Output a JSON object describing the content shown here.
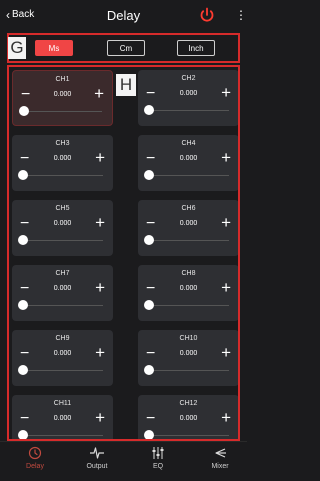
{
  "header": {
    "back_label": "Back",
    "title": "Delay",
    "power_icon": "power-icon",
    "more_icon": "more-vertical-icon"
  },
  "units": {
    "options": [
      "Ms",
      "Cm",
      "Inch"
    ],
    "selected": "Ms"
  },
  "annotations": {
    "g": "G",
    "h": "H"
  },
  "channels": [
    {
      "name": "CH1",
      "value": "0.000"
    },
    {
      "name": "CH2",
      "value": "0.000"
    },
    {
      "name": "CH3",
      "value": "0.000"
    },
    {
      "name": "CH4",
      "value": "0.000"
    },
    {
      "name": "CH5",
      "value": "0.000"
    },
    {
      "name": "CH6",
      "value": "0.000"
    },
    {
      "name": "CH7",
      "value": "0.000"
    },
    {
      "name": "CH8",
      "value": "0.000"
    },
    {
      "name": "CH9",
      "value": "0.000"
    },
    {
      "name": "CH10",
      "value": "0.000"
    },
    {
      "name": "CH11",
      "value": "0.000"
    },
    {
      "name": "CH12",
      "value": "0.000"
    }
  ],
  "controls": {
    "minus": "−",
    "plus": "+"
  },
  "tabs": [
    {
      "label": "Delay",
      "icon": "clock-icon",
      "active": true
    },
    {
      "label": "Output",
      "icon": "waveform-icon",
      "active": false
    },
    {
      "label": "EQ",
      "icon": "equalizer-icon",
      "active": false
    },
    {
      "label": "Mixer",
      "icon": "mixer-icon",
      "active": false
    }
  ],
  "colors": {
    "accent": "#f04545",
    "highlight_border": "#d62b2b",
    "card_bg": "#2e2f33",
    "background": "#1b1b1d",
    "active_tab": "#c14a3f"
  }
}
